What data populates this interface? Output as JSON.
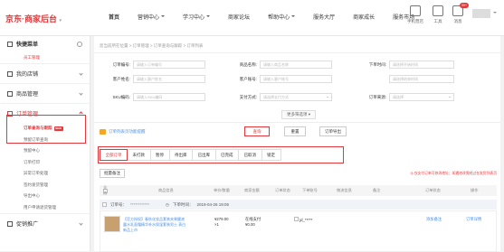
{
  "brand": {
    "name": "京东·商家后台",
    "caret": "▾"
  },
  "nav": [
    "首页",
    "营销中心",
    "学习中心",
    "商家论坛",
    "帮助中心",
    "服务大厅",
    "商家成长",
    "服务市场"
  ],
  "tools": {
    "mobile": "手机营店",
    "tools": "工具",
    "messages": "消息",
    "msg_badge": "99+"
  },
  "sidebar": {
    "quick_menu": "快捷菜单",
    "quick_sub": "员工管理",
    "groups": [
      "我的店铺",
      "商品管理",
      "订单管理"
    ],
    "order_items": [
      "订单查询与跟踪",
      "预留订单查询",
      "预留中心",
      "订单打印",
      "异常订单处理",
      "签约发货管理",
      "导出中心",
      "用户申请退货管理"
    ],
    "bottom_group": "促销推广",
    "new_tag": "NEW"
  },
  "breadcrumb": "您当前所在位置 > 订单管理 > 订单查询与跟踪 > 订单列表",
  "filters": {
    "order_no": {
      "label": "订单编号:",
      "placeholder": "请输入订单编号"
    },
    "product_name": {
      "label": "商品名称:",
      "placeholder": "请输入商品名称"
    },
    "order_time": {
      "label": "下单时间:",
      "placeholder": "请选择开始时间"
    },
    "customer_acct": {
      "label": "客户姓名:",
      "placeholder": "请输入客户姓名"
    },
    "customer_id": {
      "label": "客户账号:",
      "placeholder": "请输入客户账号"
    },
    "end_time": {
      "placeholder": "请选择结束时间"
    },
    "sku": {
      "label": "SKU编码:",
      "placeholder": "请输入SKU编码"
    },
    "pay_method": {
      "label": "支付方式:",
      "placeholder": "请选择支付方式"
    },
    "order_source": {
      "label": "订单来源:",
      "placeholder": "请选择"
    }
  },
  "more_filter": "更多筛选项 ▾",
  "notice": "订单列表页功能提醒",
  "buttons": {
    "query": "查询",
    "reset": "重置",
    "export": "订单导出",
    "batch": "批量备注"
  },
  "tabs": [
    "全部订单",
    "未打款",
    "暂停",
    "待出库",
    "已出库",
    "已完成",
    "已取消",
    "锁定"
  ],
  "tip": "◎ 仅支付订单可修改地址；如遇修改需经过在发货列表页",
  "table_head": [
    "全选",
    "商品信息",
    "单价/数量",
    "商家金额",
    "订单状态",
    "下单账号",
    "物流信息",
    "备注",
    "订单状态",
    "操作"
  ],
  "order": {
    "number_label": "订单号：",
    "number": "************",
    "time_label": "下单时间：",
    "time": "2019-04-26 19:05",
    "product": "【官方授权】春秋化妆品套装夹果醒液露水乳面霜精华补水保湿套装男士 表白 新品上市",
    "price": "¥279.00",
    "qty": "×1",
    "pay_status": "在线支付",
    "paid": "¥0.00",
    "account": "jd_*****",
    "memo_action": "添加备注",
    "op": "订单详情",
    "status_word": "已锁定"
  }
}
